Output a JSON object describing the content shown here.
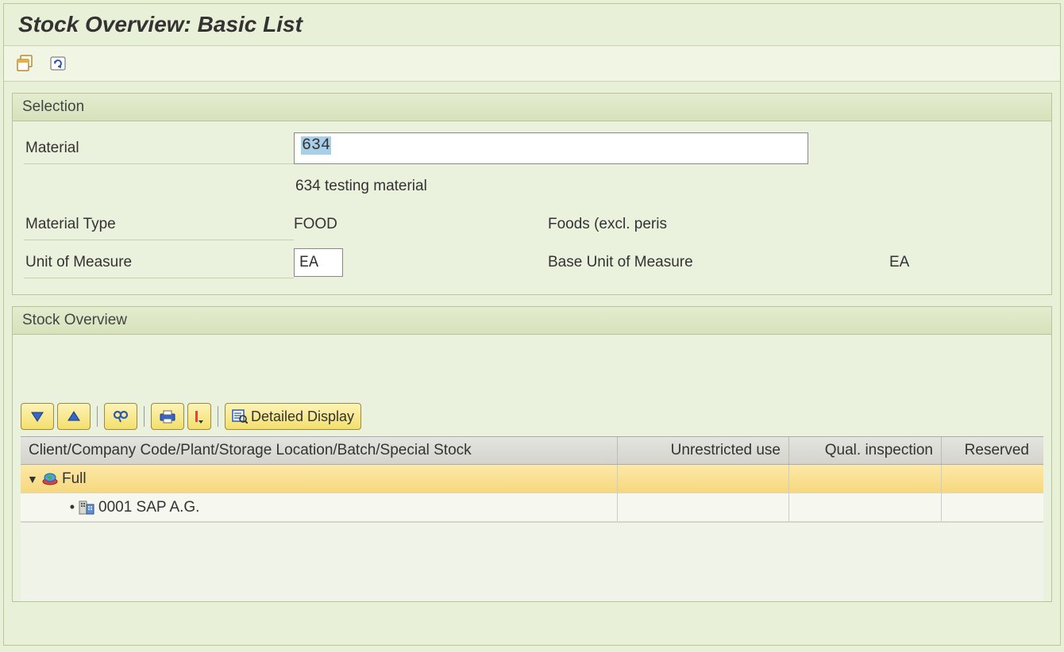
{
  "page": {
    "title": "Stock Overview: Basic List"
  },
  "selection": {
    "header": "Selection",
    "fields": {
      "material_label": "Material",
      "material_value": "634",
      "material_desc": "634 testing material",
      "material_type_label": "Material Type",
      "material_type_value": "FOOD",
      "material_type_desc": "Foods (excl. peris",
      "uom_label": "Unit of Measure",
      "uom_value": "EA",
      "base_uom_label": "Base Unit of Measure",
      "base_uom_value": "EA"
    }
  },
  "overview": {
    "header": "Stock Overview",
    "toolbar": {
      "detailed_display": "Detailed Display"
    },
    "columns": {
      "c1": "Client/Company Code/Plant/Storage Location/Batch/Special Stock",
      "c2": "Unrestricted use",
      "c3": "Qual. inspection",
      "c4": "Reserved"
    },
    "rows": [
      {
        "label": "Full",
        "expanded": true
      },
      {
        "label": "0001 SAP A.G."
      }
    ]
  }
}
